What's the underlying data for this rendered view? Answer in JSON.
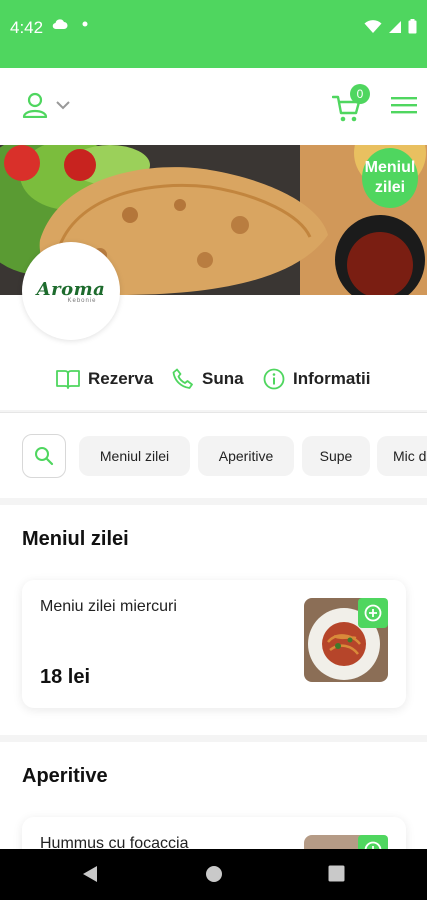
{
  "status_bar": {
    "time": "4:42"
  },
  "header": {
    "cart_count": "0"
  },
  "hero": {
    "badge_line1": "Meniul",
    "badge_line2": "zilei"
  },
  "restaurant": {
    "logo_text": "Aroma",
    "logo_subtext": "Kebonie"
  },
  "actions": [
    {
      "label": "Rezerva",
      "icon": "book-icon"
    },
    {
      "label": "Suna",
      "icon": "phone-icon"
    },
    {
      "label": "Informatii",
      "icon": "info-icon"
    }
  ],
  "tabs": [
    "Meniul zilei",
    "Aperitive",
    "Supe",
    "Mic d"
  ],
  "sections": [
    {
      "title": "Meniul zilei",
      "items": [
        {
          "name": "Meniu zilei miercuri",
          "price": "18 lei"
        }
      ]
    },
    {
      "title": "Aperitive",
      "items": [
        {
          "name": "Hummus cu focaccia"
        }
      ]
    }
  ],
  "colors": {
    "accent": "#4fd65f",
    "status_bar": "#4fd65f",
    "nav_bar": "#000000"
  }
}
